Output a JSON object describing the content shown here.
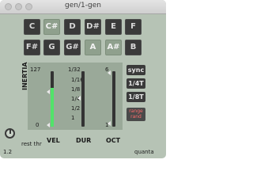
{
  "window": {
    "title": "gen/1-gen"
  },
  "keys": {
    "row1": [
      {
        "label": "C",
        "on": false
      },
      {
        "label": "C#",
        "on": true
      },
      {
        "label": "D",
        "on": false
      },
      {
        "label": "D#",
        "on": false
      },
      {
        "label": "E",
        "on": false
      },
      {
        "label": "F",
        "on": false
      }
    ],
    "row2": [
      {
        "label": "F#",
        "on": false
      },
      {
        "label": "G",
        "on": false
      },
      {
        "label": "G#",
        "on": false
      },
      {
        "label": "A",
        "on": true
      },
      {
        "label": "A#",
        "on": true
      },
      {
        "label": "B",
        "on": false
      }
    ]
  },
  "controls": {
    "inertia_label": "INERTIA",
    "inertia_top": "127",
    "inertia_bottom": "0",
    "rest_label": "rest thr",
    "vel_label": "VEL",
    "dur_label": "DUR",
    "oct_label": "OCT",
    "dur_top": "1/32",
    "dur_marks": [
      "1/16",
      "1/8",
      "1/4",
      "1/2",
      "1"
    ],
    "oct_top": "6",
    "oct_bottom": "1",
    "version": "1.2",
    "brand": "quanta"
  },
  "buttons": {
    "sync": "sync",
    "quarter_t": "1/4T",
    "eighth_t": "1/8T",
    "range_rand_line1": "range",
    "range_rand_line2": "rand"
  },
  "levels": {
    "vel_fill_fraction": 0.7
  },
  "colors": {
    "bg": "#b6c3b5",
    "key": "#3a3a3a",
    "key_on": "#8fa08d",
    "fill": "#51e36a",
    "accent_text": "#ff6b6b"
  }
}
